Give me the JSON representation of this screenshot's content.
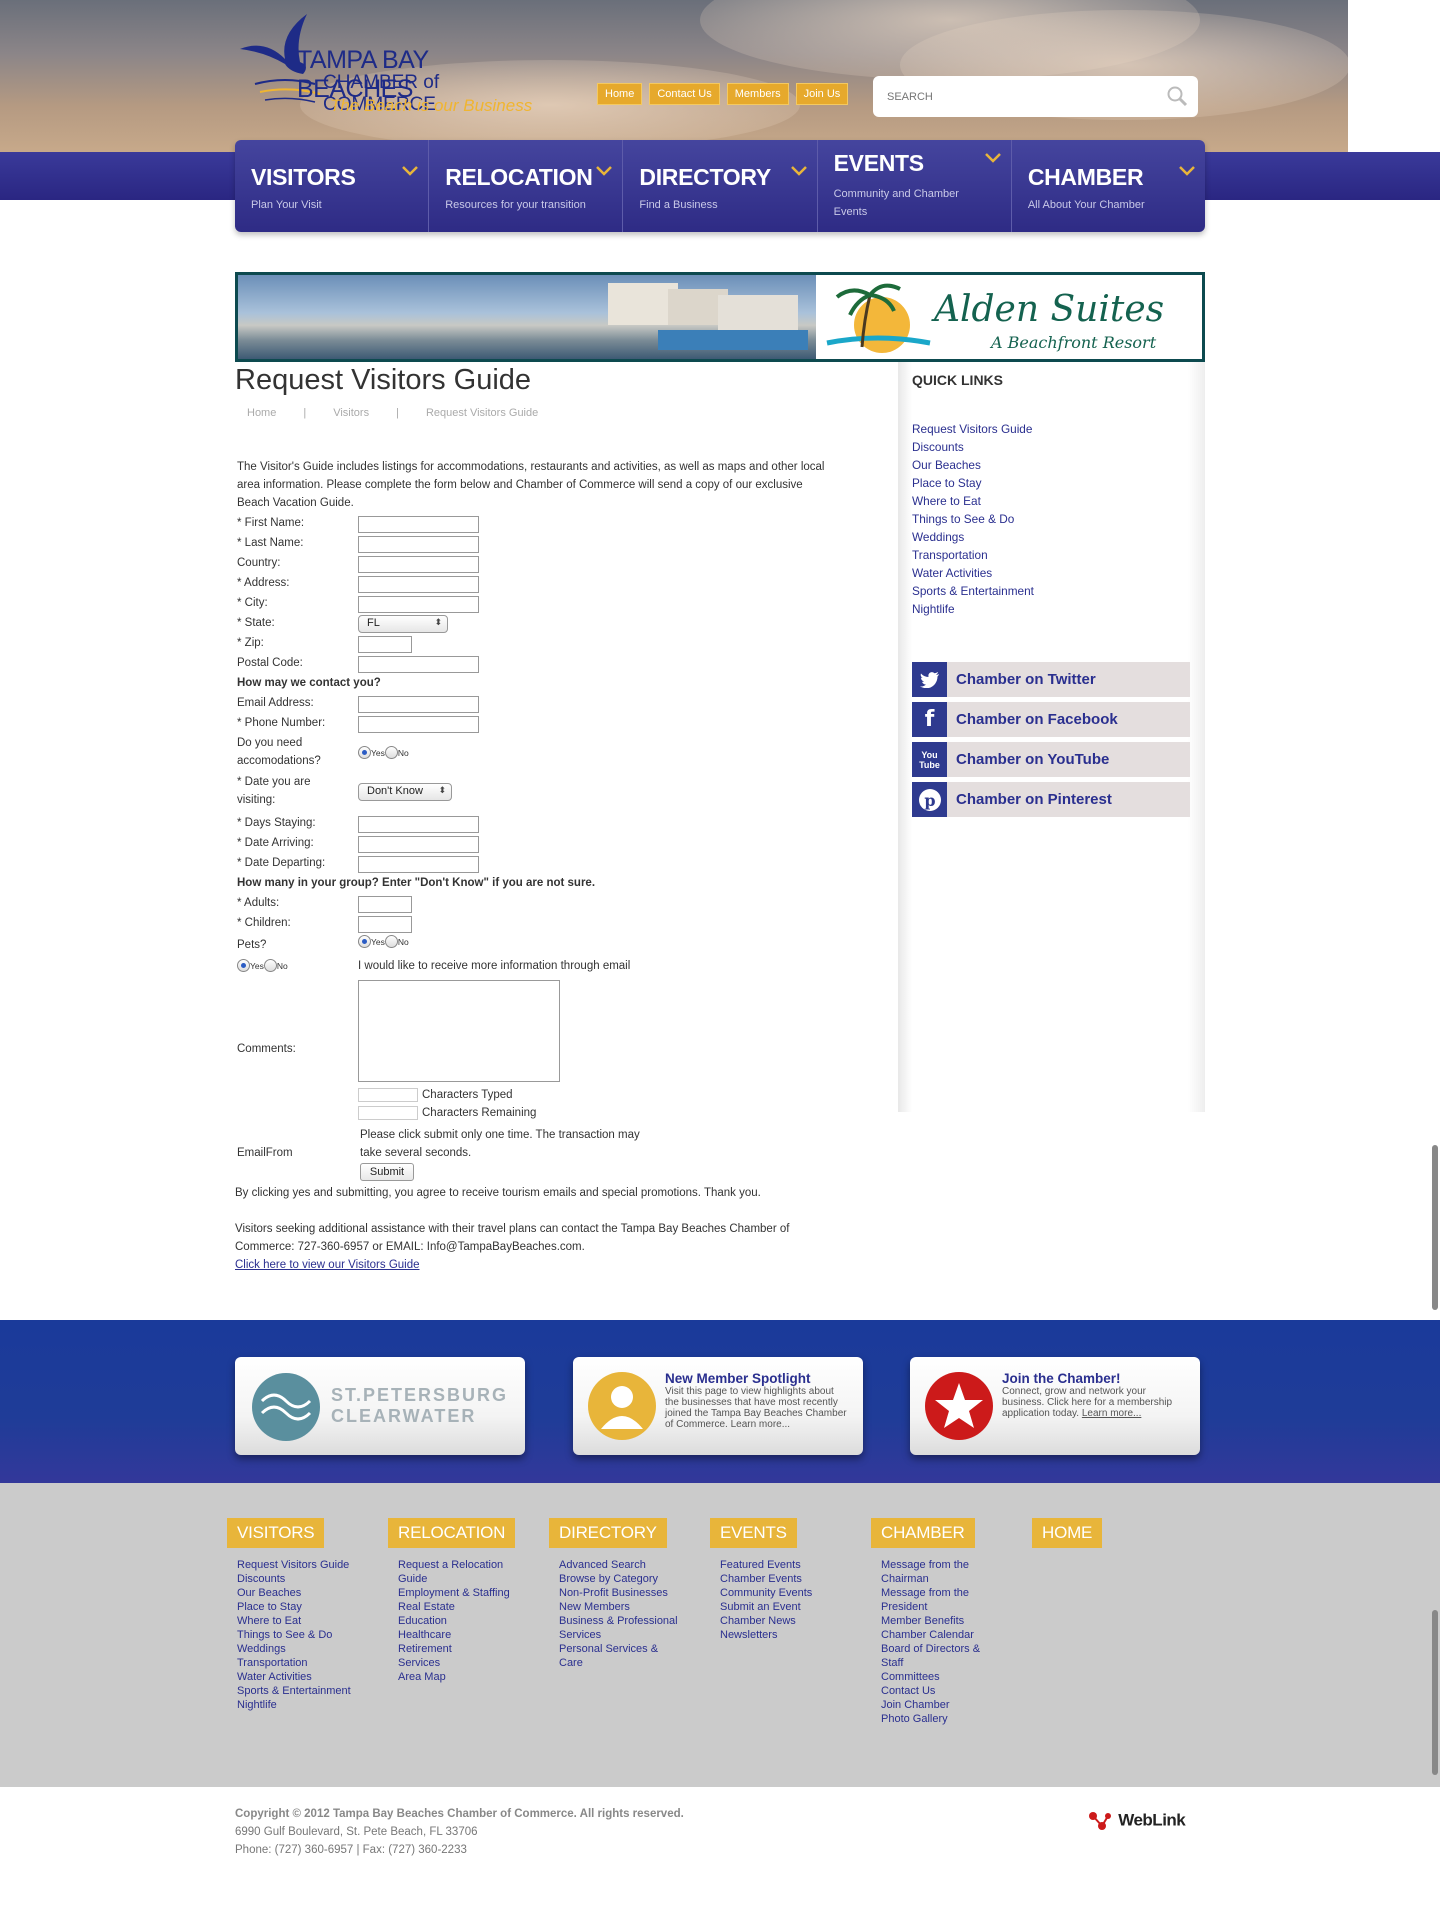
{
  "header": {
    "logo_line1": "TAMPA BAY BEACHES",
    "logo_line2": "CHAMBER of COMMERCE",
    "logo_tagline": "The Beach is our Business",
    "top_links": [
      "Home",
      "Contact Us",
      "Members",
      "Join Us"
    ],
    "search_placeholder": "SEARCH"
  },
  "nav": [
    {
      "title": "VISITORS",
      "sub": "Plan Your Visit"
    },
    {
      "title": "RELOCATION",
      "sub": "Resources for your transition"
    },
    {
      "title": "DIRECTORY",
      "sub": "Find a Business"
    },
    {
      "title": "EVENTS",
      "sub": "Community and Chamber Events"
    },
    {
      "title": "CHAMBER",
      "sub": "All About Your Chamber"
    }
  ],
  "banner": {
    "name": "Alden Suites",
    "tagline": "A Beachfront Resort"
  },
  "page": {
    "title": "Request Visitors Guide",
    "breadcrumb": [
      "Home",
      "|",
      "Visitors",
      "|",
      "Request Visitors Guide"
    ],
    "intro": "The Visitor's Guide includes listings for accommodations, restaurants and activities, as well as maps and other local area information. Please complete the form below and Chamber of Commerce will send a copy of our exclusive Beach Vacation Guide."
  },
  "form": {
    "first_name": "* First Name:",
    "last_name": "* Last Name:",
    "country": "Country:",
    "address": "* Address:",
    "city": "* City:",
    "state": "* State:",
    "state_value": "FL",
    "zip": "* Zip:",
    "postal": "Postal Code:",
    "contact_heading": "How may we contact you?",
    "email": "Email Address:",
    "phone": "* Phone Number:",
    "accom_q1": "Do you need",
    "accom_q2": "accomodations?",
    "date_q1": "* Date you are",
    "date_q2": "visiting:",
    "date_value": "Don't Know",
    "days": "* Days Staying:",
    "arriving": "* Date Arriving:",
    "departing": "* Date Departing:",
    "group_heading": "How many in your group? Enter \"Don't Know\" if you are not sure.",
    "adults": "* Adults:",
    "children": "* Children:",
    "pets": "Pets?",
    "yes": "Yes",
    "no": "No",
    "email_optin": "I would like to receive more information through email",
    "comments": "Comments:",
    "chars_typed": "Characters Typed",
    "chars_remaining": "Characters Remaining",
    "submit_note1": "Please click submit only one time.  The transaction may",
    "submit_note2": "take several seconds.",
    "email_from": "EmailFrom",
    "submit": "Submit"
  },
  "after_form": {
    "agree": "By clicking yes and submitting, you agree to receive tourism emails and special promotions. Thank you.",
    "contact1": "Visitors seeking additional assistance with their travel plans can contact the Tampa Bay Beaches Chamber of",
    "contact2": "Commerce: 727-360-6957 or EMAIL: Info@TampaBayBeaches.com.",
    "guide_link": "Click here to view our Visitors Guide"
  },
  "sidebar": {
    "heading": "QUICK LINKS",
    "links": [
      "Request Visitors Guide",
      "Discounts",
      "Our Beaches",
      "Place to Stay",
      "Where to Eat",
      "Things to See & Do",
      "Weddings",
      "Transportation",
      "Water Activities",
      "Sports & Entertainment",
      "Nightlife"
    ],
    "social": [
      {
        "label": "Chamber on Twitter",
        "icon": "twitter-icon"
      },
      {
        "label": "Chamber on Facebook",
        "icon": "facebook-icon"
      },
      {
        "label": "Chamber on YouTube",
        "icon": "youtube-icon"
      },
      {
        "label": "Chamber on Pinterest",
        "icon": "pinterest-icon"
      }
    ]
  },
  "promo": {
    "stpete1": "ST.PETERSBURG",
    "stpete2": "CLEARWATER",
    "spotlight_title": "New Member Spotlight",
    "spotlight_body": "Visit this page to view highlights about the businesses that have most recently joined the Tampa Bay Beaches Chamber of Commerce.",
    "spotlight_more": "Learn more...",
    "join_title": "Join the Chamber!",
    "join_body": "Connect, grow and network your business. Click here for a membership application today.",
    "join_more": "Learn more..."
  },
  "footer_nav": [
    {
      "title": "VISITORS",
      "links": [
        "Request Visitors Guide",
        "Discounts",
        "Our Beaches",
        "Place to Stay",
        "Where to Eat",
        "Things to See & Do",
        "Weddings",
        "Transportation",
        "Water Activities",
        "Sports & Entertainment",
        "Nightlife"
      ]
    },
    {
      "title": "RELOCATION",
      "links": [
        "Request a Relocation Guide",
        "Employment & Staffing",
        "Real Estate",
        "Education",
        "Healthcare",
        "Retirement Services",
        "Area Map"
      ]
    },
    {
      "title": "DIRECTORY",
      "links": [
        "Advanced Search",
        "Browse by Category",
        "Non-Profit Businesses",
        "New Members",
        "Business & Professional Services",
        "Personal Services & Care"
      ]
    },
    {
      "title": "EVENTS",
      "links": [
        "Featured Events",
        "Chamber Events",
        "Community Events",
        "Submit an Event",
        "Chamber News",
        "Newsletters"
      ]
    },
    {
      "title": "CHAMBER",
      "links": [
        "Message from the Chairman",
        "Message from the President",
        "Member Benefits",
        "Chamber Calendar",
        "Board of Directors & Staff",
        "Committees",
        "Contact Us",
        "Join Chamber",
        "Photo Gallery"
      ]
    },
    {
      "title": "HOME",
      "links": []
    }
  ],
  "copyright": {
    "line1": "Copyright © 2012 Tampa Bay Beaches Chamber of Commerce.  All rights reserved.",
    "line2": "6990 Gulf Boulevard, St. Pete Beach, FL 33706",
    "line3": "Phone: (727) 360-6957 | Fax: (727) 360-2233",
    "weblink": "WebLink"
  }
}
